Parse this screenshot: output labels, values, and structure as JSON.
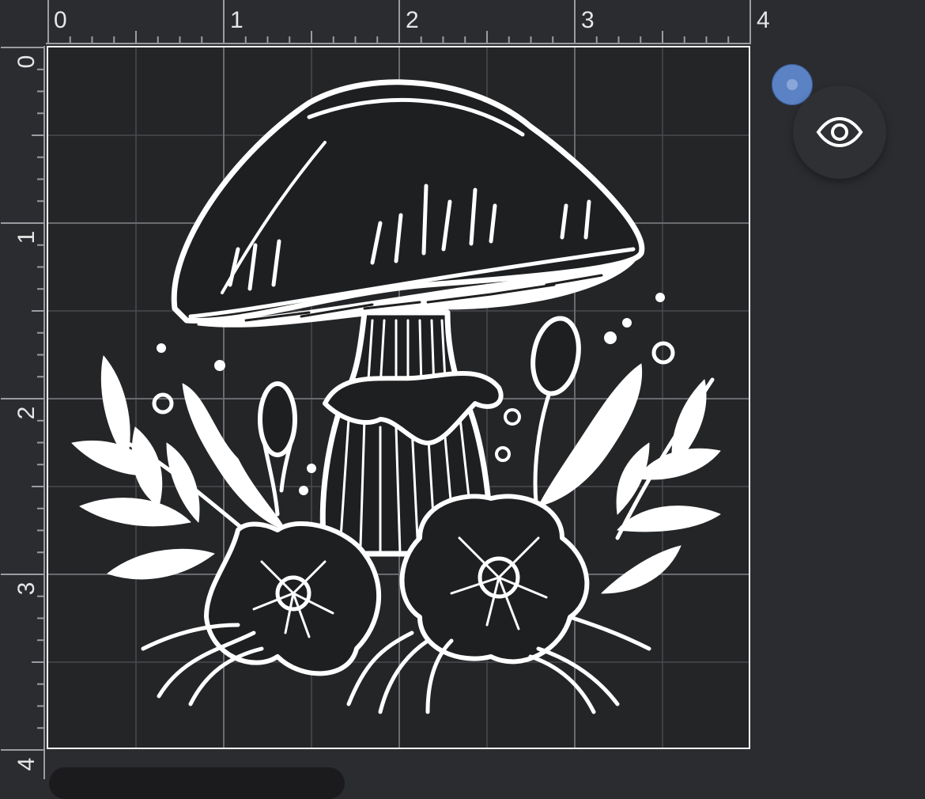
{
  "ruler": {
    "horizontal_labels": [
      "0",
      "1",
      "2",
      "3",
      "4"
    ],
    "vertical_labels": [
      "0",
      "1",
      "2",
      "3",
      "4"
    ]
  },
  "canvas": {
    "design": "mushroom-and-flowers-line-art"
  },
  "controls": {
    "handle_icon": "selection-handle",
    "eye_icon": "eye-icon"
  },
  "colors": {
    "background": "#2b2c30",
    "mat": "#242527",
    "design_line": "#ffffff",
    "handle": "#5b82c4"
  }
}
